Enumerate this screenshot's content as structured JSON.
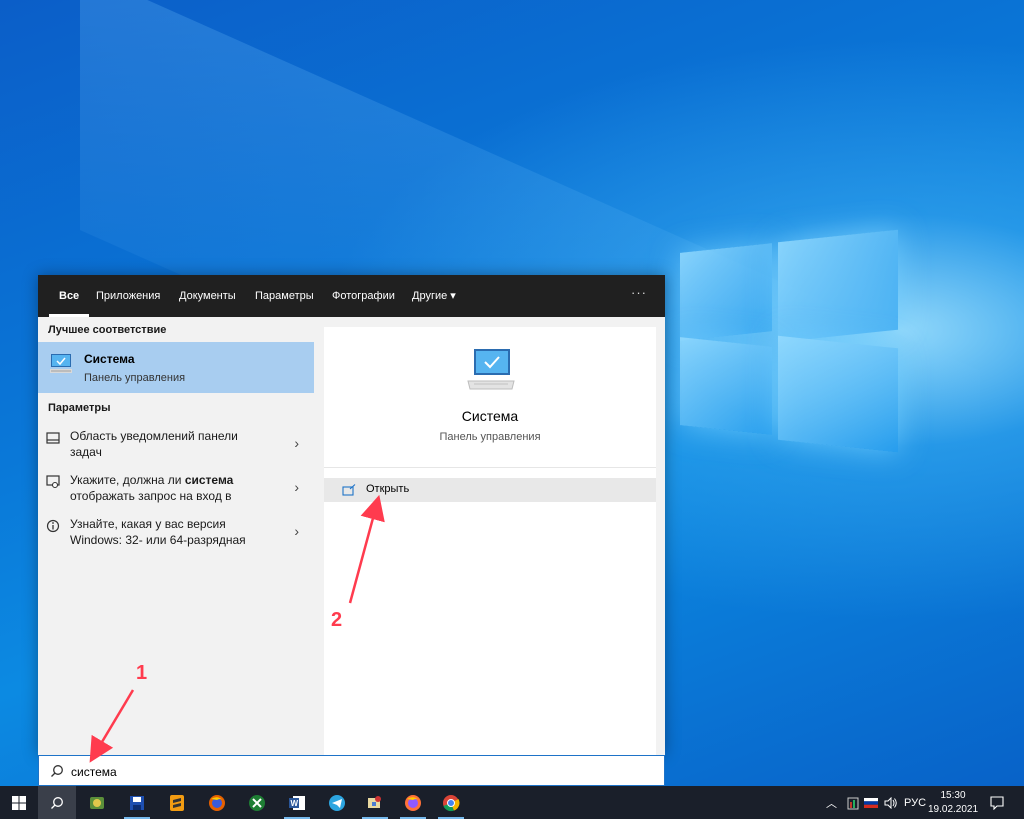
{
  "search_panel": {
    "tabs": [
      {
        "label": "Все",
        "active": true
      },
      {
        "label": "Приложения"
      },
      {
        "label": "Документы"
      },
      {
        "label": "Параметры"
      },
      {
        "label": "Фотографии"
      },
      {
        "label": "Другие ▾"
      }
    ],
    "more_label": "···",
    "best_match": {
      "section_title": "Лучшее соответствие",
      "name": "Система",
      "subtitle": "Панель управления",
      "icon": "monitor-icon"
    },
    "settings": {
      "section_title": "Параметры",
      "items": [
        {
          "lines": [
            "Область уведомлений панели",
            "задач"
          ],
          "icon": "taskbar-settings-icon"
        },
        {
          "pre": "Укажите, должна ли ",
          "bold": "система",
          "line2": "отображать запрос на вход в",
          "icon": "signin-settings-icon"
        },
        {
          "lines": [
            "Узнайте, какая у вас версия",
            "Windows: 32- или 64-разрядная"
          ],
          "icon": "info-icon"
        }
      ]
    },
    "preview": {
      "title": "Система",
      "subtitle": "Панель управления",
      "icon": "monitor-icon",
      "actions": [
        {
          "label": "Открыть",
          "icon": "open-icon"
        }
      ]
    },
    "search": {
      "value": "система"
    }
  },
  "annotations": [
    {
      "label": "1",
      "color": "#ff3b4e"
    },
    {
      "label": "2",
      "color": "#ff3b4e"
    }
  ],
  "taskbar": {
    "tray": {
      "language": "РУС",
      "time": "15:30",
      "date": "19.02.2021"
    }
  }
}
